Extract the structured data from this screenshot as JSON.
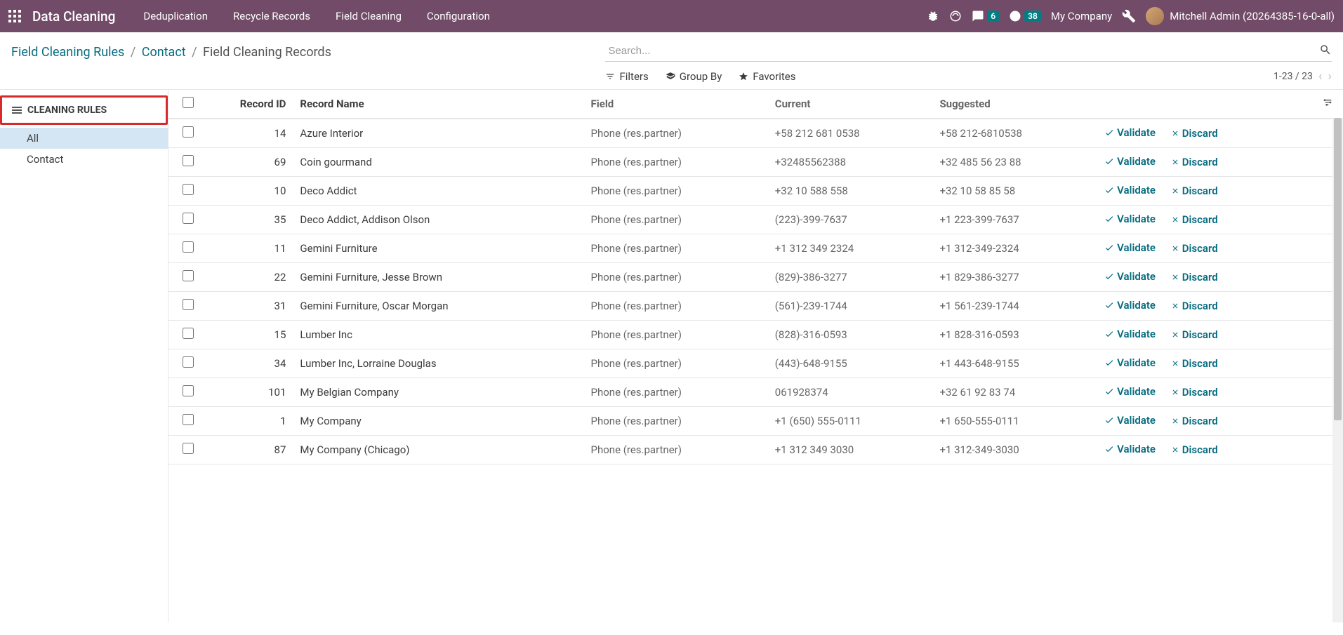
{
  "navbar": {
    "brand": "Data Cleaning",
    "menu": [
      "Deduplication",
      "Recycle Records",
      "Field Cleaning",
      "Configuration"
    ],
    "discuss_badge": "6",
    "activities_badge": "38",
    "company": "My Company",
    "user": "Mitchell Admin (20264385-16-0-all)"
  },
  "breadcrumbs": {
    "crumb1": "Field Cleaning Rules",
    "crumb2": "Contact",
    "current": "Field Cleaning Records"
  },
  "search": {
    "placeholder": "Search...",
    "filters_label": "Filters",
    "groupby_label": "Group By",
    "favorites_label": "Favorites",
    "pager": "1-23 / 23"
  },
  "sidebar": {
    "header": "CLEANING RULES",
    "items": [
      {
        "label": "All",
        "active": true
      },
      {
        "label": "Contact",
        "active": false
      }
    ]
  },
  "table": {
    "headers": {
      "record_id": "Record ID",
      "record_name": "Record Name",
      "field": "Field",
      "current": "Current",
      "suggested": "Suggested"
    },
    "validate_label": "Validate",
    "discard_label": "Discard",
    "rows": [
      {
        "id": "14",
        "name": "Azure Interior",
        "field": "Phone (res.partner)",
        "current": "+58 212 681 0538",
        "suggested": "+58 212-6810538"
      },
      {
        "id": "69",
        "name": "Coin gourmand",
        "field": "Phone (res.partner)",
        "current": "+32485562388",
        "suggested": "+32 485 56 23 88"
      },
      {
        "id": "10",
        "name": "Deco Addict",
        "field": "Phone (res.partner)",
        "current": "+32 10 588 558",
        "suggested": "+32 10 58 85 58"
      },
      {
        "id": "35",
        "name": "Deco Addict, Addison Olson",
        "field": "Phone (res.partner)",
        "current": "(223)-399-7637",
        "suggested": "+1 223-399-7637"
      },
      {
        "id": "11",
        "name": "Gemini Furniture",
        "field": "Phone (res.partner)",
        "current": "+1 312 349 2324",
        "suggested": "+1 312-349-2324"
      },
      {
        "id": "22",
        "name": "Gemini Furniture, Jesse Brown",
        "field": "Phone (res.partner)",
        "current": "(829)-386-3277",
        "suggested": "+1 829-386-3277"
      },
      {
        "id": "31",
        "name": "Gemini Furniture, Oscar Morgan",
        "field": "Phone (res.partner)",
        "current": "(561)-239-1744",
        "suggested": "+1 561-239-1744"
      },
      {
        "id": "15",
        "name": "Lumber Inc",
        "field": "Phone (res.partner)",
        "current": "(828)-316-0593",
        "suggested": "+1 828-316-0593"
      },
      {
        "id": "34",
        "name": "Lumber Inc, Lorraine Douglas",
        "field": "Phone (res.partner)",
        "current": "(443)-648-9155",
        "suggested": "+1 443-648-9155"
      },
      {
        "id": "101",
        "name": "My Belgian Company",
        "field": "Phone (res.partner)",
        "current": "061928374",
        "suggested": "+32 61 92 83 74"
      },
      {
        "id": "1",
        "name": "My Company",
        "field": "Phone (res.partner)",
        "current": "+1 (650) 555-0111",
        "suggested": "+1 650-555-0111"
      },
      {
        "id": "87",
        "name": "My Company (Chicago)",
        "field": "Phone (res.partner)",
        "current": "+1 312 349 3030",
        "suggested": "+1 312-349-3030"
      }
    ]
  }
}
